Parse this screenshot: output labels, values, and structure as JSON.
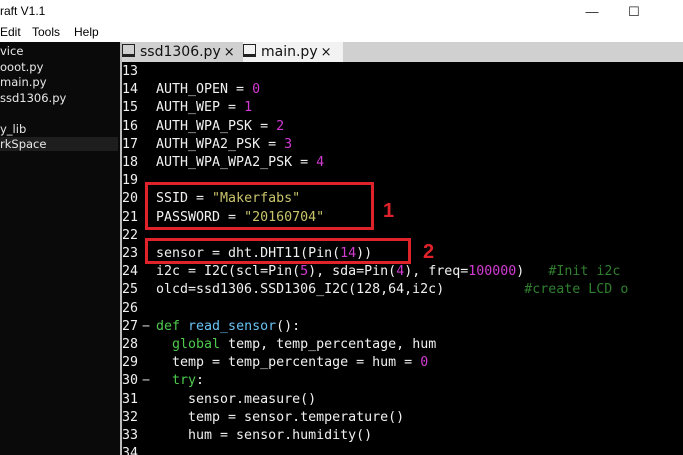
{
  "window": {
    "title": "raft V1.1",
    "min_glyph": "—",
    "max_glyph": "☐"
  },
  "menu": [
    "Edit",
    "Tools",
    "Help"
  ],
  "sidebar": {
    "items": [
      "vice",
      "ooot.py",
      "main.py",
      "ssd1306.py",
      "",
      "y_lib",
      "rkSpace"
    ]
  },
  "tabs": [
    {
      "label": "ssd1306.py",
      "close": "×"
    },
    {
      "label": "main.py",
      "close": "×"
    }
  ],
  "code": [
    {
      "n": "13",
      "t": [
        {
          "c": "v",
          "s": ""
        }
      ]
    },
    {
      "n": "14",
      "t": [
        {
          "c": "v",
          "s": "AUTH_OPEN = "
        },
        {
          "c": "n",
          "s": "0"
        }
      ]
    },
    {
      "n": "15",
      "t": [
        {
          "c": "v",
          "s": "AUTH_WEP = "
        },
        {
          "c": "n",
          "s": "1"
        }
      ]
    },
    {
      "n": "16",
      "t": [
        {
          "c": "v",
          "s": "AUTH_WPA_PSK = "
        },
        {
          "c": "n",
          "s": "2"
        }
      ]
    },
    {
      "n": "17",
      "t": [
        {
          "c": "v",
          "s": "AUTH_WPA2_PSK = "
        },
        {
          "c": "n",
          "s": "3"
        }
      ]
    },
    {
      "n": "18",
      "t": [
        {
          "c": "v",
          "s": "AUTH_WPA_WPA2_PSK = "
        },
        {
          "c": "n",
          "s": "4"
        }
      ]
    },
    {
      "n": "19",
      "t": [
        {
          "c": "v",
          "s": ""
        }
      ]
    },
    {
      "n": "20",
      "t": [
        {
          "c": "v",
          "s": "SSID = "
        },
        {
          "c": "s",
          "s": "\"Makerfabs\""
        }
      ]
    },
    {
      "n": "21",
      "t": [
        {
          "c": "v",
          "s": "PASSWORD = "
        },
        {
          "c": "s",
          "s": "\"20160704\""
        }
      ]
    },
    {
      "n": "22",
      "t": [
        {
          "c": "v",
          "s": ""
        }
      ]
    },
    {
      "n": "23",
      "t": [
        {
          "c": "v",
          "s": "sensor = dht.DHT11(Pin("
        },
        {
          "c": "n",
          "s": "14"
        },
        {
          "c": "v",
          "s": "))"
        }
      ]
    },
    {
      "n": "24",
      "t": [
        {
          "c": "v",
          "s": "i2c = I2C(scl=Pin("
        },
        {
          "c": "n",
          "s": "5"
        },
        {
          "c": "v",
          "s": "), sda=Pin("
        },
        {
          "c": "n",
          "s": "4"
        },
        {
          "c": "v",
          "s": "), freq="
        },
        {
          "c": "n",
          "s": "100000"
        },
        {
          "c": "v",
          "s": ")   "
        },
        {
          "c": "c",
          "s": "#Init i2c"
        }
      ]
    },
    {
      "n": "25",
      "t": [
        {
          "c": "v",
          "s": "olcd=ssd1306.SSD1306_I2C(128,64,i2c)          "
        },
        {
          "c": "c",
          "s": "#create LCD o"
        }
      ]
    },
    {
      "n": "26",
      "t": [
        {
          "c": "v",
          "s": ""
        }
      ]
    },
    {
      "n": "27",
      "fold": "−",
      "t": [
        {
          "c": "k",
          "s": "def "
        },
        {
          "c": "f",
          "s": "read_sensor"
        },
        {
          "c": "v",
          "s": "():"
        }
      ]
    },
    {
      "n": "28",
      "t": [
        {
          "c": "v",
          "s": "  "
        },
        {
          "c": "k",
          "s": "global"
        },
        {
          "c": "v",
          "s": " temp, temp_percentage, hum"
        }
      ]
    },
    {
      "n": "29",
      "t": [
        {
          "c": "v",
          "s": "  temp = temp_percentage = hum = "
        },
        {
          "c": "n",
          "s": "0"
        }
      ]
    },
    {
      "n": "30",
      "fold": "−",
      "t": [
        {
          "c": "v",
          "s": "  "
        },
        {
          "c": "k",
          "s": "try"
        },
        {
          "c": "v",
          "s": ":"
        }
      ]
    },
    {
      "n": "31",
      "t": [
        {
          "c": "v",
          "s": "    sensor.measure()"
        }
      ]
    },
    {
      "n": "32",
      "t": [
        {
          "c": "v",
          "s": "    temp = sensor.temperature()"
        }
      ]
    },
    {
      "n": "33",
      "t": [
        {
          "c": "v",
          "s": "    hum = sensor.humidity()"
        }
      ]
    },
    {
      "n": "34",
      "t": [
        {
          "c": "v",
          "s": ""
        }
      ]
    }
  ],
  "annotations": [
    "1",
    "2"
  ],
  "colors": {
    "annotation": "#e0232b",
    "keyword": "#4ec94e",
    "string": "#c8c46a",
    "number": "#d23bd2",
    "function": "#69c3f5",
    "comment": "#2f7f2f"
  }
}
